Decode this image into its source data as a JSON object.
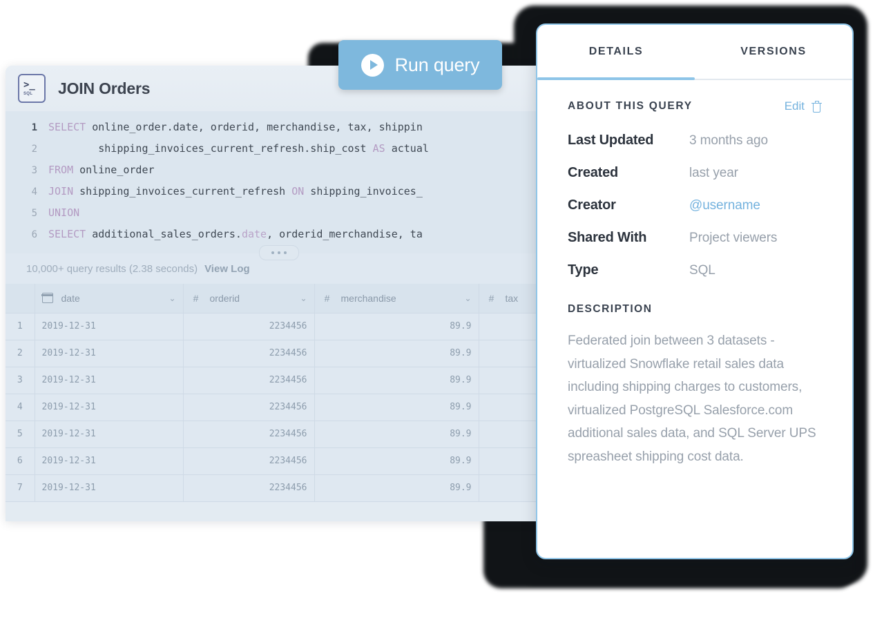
{
  "query_card": {
    "icon_prompt": ">_",
    "icon_tag": "SQL",
    "title": "JOIN Orders",
    "code_lines": [
      {
        "number": "1",
        "segments": [
          {
            "t": "SELECT",
            "c": "kw"
          },
          {
            "t": " online_order.date, orderid, merchandise, tax, shippin",
            "c": "code-text"
          }
        ]
      },
      {
        "number": "2",
        "segments": [
          {
            "t": "        shipping_invoices_current_refresh.ship_cost ",
            "c": "code-text"
          },
          {
            "t": "AS",
            "c": "kw"
          },
          {
            "t": " actual",
            "c": "code-text"
          }
        ]
      },
      {
        "number": "3",
        "segments": [
          {
            "t": "FROM",
            "c": "kw"
          },
          {
            "t": " online_order",
            "c": "code-text"
          }
        ]
      },
      {
        "number": "4",
        "segments": [
          {
            "t": "JOIN",
            "c": "kw"
          },
          {
            "t": " shipping_invoices_current_refresh ",
            "c": "code-text"
          },
          {
            "t": "ON",
            "c": "kw"
          },
          {
            "t": " shipping_invoices_",
            "c": "code-text"
          }
        ]
      },
      {
        "number": "5",
        "segments": [
          {
            "t": "UNION",
            "c": "kw"
          }
        ]
      },
      {
        "number": "6",
        "segments": [
          {
            "t": "SELECT",
            "c": "kw"
          },
          {
            "t": " additional_sales_orders.",
            "c": "code-text"
          },
          {
            "t": "date",
            "c": "fn"
          },
          {
            "t": ", orderid_merchandise, ta",
            "c": "code-text"
          }
        ]
      }
    ],
    "status": {
      "results_text": "10,000+ query results (2.38 seconds)",
      "view_log_label": "View Log"
    },
    "table": {
      "columns": [
        {
          "key": "idx",
          "label": "",
          "type_icon": "",
          "sortable": false
        },
        {
          "key": "date",
          "label": "date",
          "type_icon": "calendar",
          "sortable": true
        },
        {
          "key": "oid",
          "label": "orderid",
          "type_icon": "#",
          "sortable": true
        },
        {
          "key": "mer",
          "label": "merchandise",
          "type_icon": "#",
          "sortable": true
        },
        {
          "key": "tax",
          "label": "tax",
          "type_icon": "#",
          "sortable": false
        }
      ],
      "rows": [
        {
          "idx": "1",
          "date": "2019-12-31",
          "oid": "2234456",
          "mer": "89.9",
          "tax": ""
        },
        {
          "idx": "2",
          "date": "2019-12-31",
          "oid": "2234456",
          "mer": "89.9",
          "tax": ""
        },
        {
          "idx": "3",
          "date": "2019-12-31",
          "oid": "2234456",
          "mer": "89.9",
          "tax": ""
        },
        {
          "idx": "4",
          "date": "2019-12-31",
          "oid": "2234456",
          "mer": "89.9",
          "tax": ""
        },
        {
          "idx": "5",
          "date": "2019-12-31",
          "oid": "2234456",
          "mer": "89.9",
          "tax": ""
        },
        {
          "idx": "6",
          "date": "2019-12-31",
          "oid": "2234456",
          "mer": "89.9",
          "tax": ""
        },
        {
          "idx": "7",
          "date": "2019-12-31",
          "oid": "2234456",
          "mer": "89.9",
          "tax": ""
        }
      ]
    }
  },
  "run_button": {
    "label": "Run query",
    "icon": "play-icon",
    "color": "#7eb8dd"
  },
  "details_panel": {
    "tabs": [
      {
        "label": "DETAILS",
        "active": true
      },
      {
        "label": "VERSIONS",
        "active": false
      }
    ],
    "about": {
      "title": "ABOUT THIS QUERY",
      "edit_label": "Edit",
      "delete_icon": "trash-icon",
      "rows": [
        {
          "key": "Last Updated",
          "value": "3 months ago",
          "link": false
        },
        {
          "key": "Created",
          "value": "last year",
          "link": false
        },
        {
          "key": "Creator",
          "value": "@username",
          "link": true
        },
        {
          "key": "Shared With",
          "value": "Project viewers",
          "link": false
        },
        {
          "key": "Type",
          "value": "SQL",
          "link": false
        }
      ]
    },
    "description": {
      "title": "DESCRIPTION",
      "text": "Federated join between 3 datasets - virtualized Snowflake retail sales data including shipping charges to customers, virtualized PostgreSQL Salesforce.com additional sales data, and SQL Server UPS spreasheet shipping cost data."
    },
    "accent_color": "#8ec5e8"
  }
}
